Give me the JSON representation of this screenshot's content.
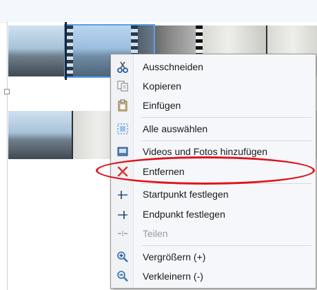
{
  "menu": {
    "items": [
      {
        "label": "Ausschneiden",
        "icon": "scissors-icon",
        "enabled": true
      },
      {
        "label": "Kopieren",
        "icon": "copy-icon",
        "enabled": true
      },
      {
        "label": "Einfügen",
        "icon": "paste-icon",
        "enabled": true
      },
      {
        "label": "Alle auswählen",
        "icon": "select-all-icon",
        "enabled": true
      },
      {
        "label": "Videos und Fotos hinzufügen",
        "icon": "add-media-icon",
        "enabled": true
      },
      {
        "label": "Entfernen",
        "icon": "remove-icon",
        "enabled": true
      },
      {
        "label": "Startpunkt festlegen",
        "icon": "set-start-point-icon",
        "enabled": true
      },
      {
        "label": "Endpunkt festlegen",
        "icon": "set-end-point-icon",
        "enabled": true
      },
      {
        "label": "Teilen",
        "icon": "split-icon",
        "enabled": false
      },
      {
        "label": "Vergrößern (+)",
        "icon": "zoom-in-icon",
        "enabled": true
      },
      {
        "label": "Verkleinern (-)",
        "icon": "zoom-out-icon",
        "enabled": true
      }
    ]
  },
  "colors": {
    "highlight_ring": "#e0131b",
    "remove_icon": "#d9302c",
    "selection": "#5aa0e8"
  }
}
